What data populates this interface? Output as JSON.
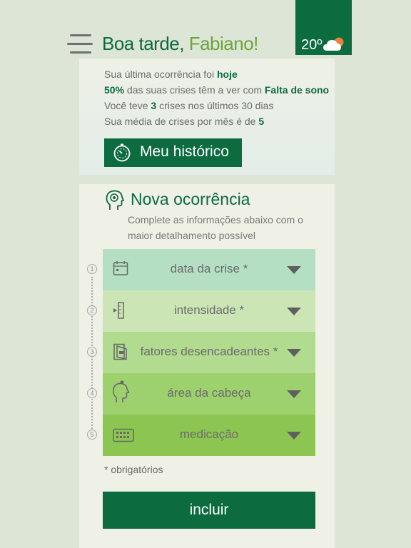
{
  "header": {
    "greeting_prefix": "Boa tarde,",
    "user_name": "Fabiano!",
    "weather_temp": "20º",
    "weather_icon": "partly-cloudy-icon",
    "menu_icon": "hamburger-menu-icon"
  },
  "summary": {
    "l1_text": "Sua última ocorrência foi ",
    "l1_bold": "hoje",
    "l2_bold": "50%",
    "l2_text": " das suas crises têm a ver com ",
    "l2_bold2": "Falta de sono",
    "l3_text": "Você teve ",
    "l3_bold": "3",
    "l3_text2": " crises nos últimos 30 dias",
    "l4_text": "Sua média de crises por mês é de ",
    "l4_bold": "5",
    "history_button": "Meu histórico"
  },
  "occurrence": {
    "title": "Nova ocorrência",
    "subtitle": "Complete as informações abaixo com o maior detalhamento possível",
    "fields": [
      {
        "step": "1",
        "label": "data da crise *",
        "icon": "calendar-icon",
        "color": "#b5dfc3"
      },
      {
        "step": "2",
        "label": "intensidade *",
        "icon": "intensity-scale-icon",
        "color": "#cce5b5"
      },
      {
        "step": "3",
        "label": "fatores desencadeantes *",
        "icon": "trigger-factors-icon",
        "color": "#b1db8e"
      },
      {
        "step": "4",
        "label": "área da cabeça",
        "icon": "head-profile-icon",
        "color": "#9dd16e"
      },
      {
        "step": "5",
        "label": "medicação",
        "icon": "medication-pills-icon",
        "color": "#8cc552"
      }
    ],
    "required_note": "* obrigatórios",
    "submit_label": "incluir"
  }
}
